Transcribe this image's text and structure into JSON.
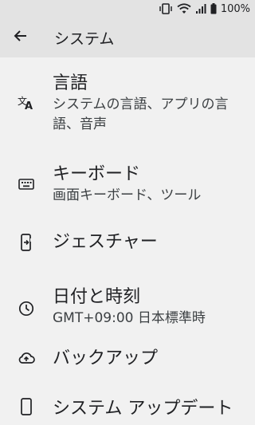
{
  "status_bar": {
    "battery_text": "100%",
    "icons": [
      "vibrate-icon",
      "wifi-icon",
      "signal-icon",
      "battery-icon"
    ]
  },
  "app_bar": {
    "title": "システム",
    "back_icon": "arrow-back-icon"
  },
  "items": [
    {
      "title": "言語",
      "subtitle": "システムの言語、アプリの言語、音声",
      "icon": "translate-icon"
    },
    {
      "title": "キーボード",
      "subtitle": "画面キーボード、ツール",
      "icon": "keyboard-icon"
    },
    {
      "title": "ジェスチャー",
      "subtitle": "",
      "icon": "gesture-phone-icon"
    },
    {
      "title": "日付と時刻",
      "subtitle": "GMT+09:00 日本標準時",
      "icon": "clock-icon"
    },
    {
      "title": "バックアップ",
      "subtitle": "",
      "icon": "cloud-upload-icon"
    },
    {
      "title": "システム アップデート",
      "subtitle": "",
      "icon": "system-update-icon"
    }
  ],
  "colors": {
    "background": "#f1f1f1",
    "app_bar": "#e3e3e3",
    "text_primary": "#202124",
    "text_secondary": "#3c4043"
  }
}
